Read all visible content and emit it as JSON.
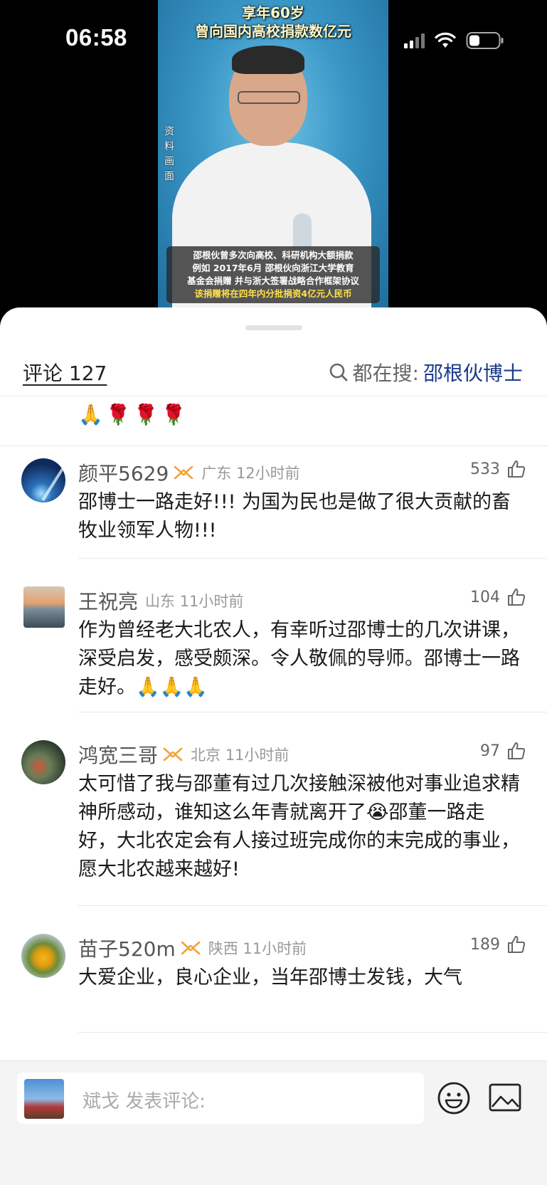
{
  "status_bar": {
    "time": "06:58"
  },
  "video": {
    "title_line1": "享年60岁",
    "title_line2": "曾向国内高校捐款数亿元",
    "side_note": [
      "资",
      "料",
      "画",
      "面"
    ],
    "caption_lines": [
      "邵根伙曾多次向高校、科研机构大额捐款",
      "例如 2017年6月 邵根伙向浙江大学教育",
      "基金会捐赠 并与浙大签署战略合作框架协议",
      "该捐赠将在四年内分批捐资4亿元人民币"
    ]
  },
  "comments_header": {
    "count_label": "评论 127",
    "search_label": "都在搜:",
    "search_term": "邵根伙博士"
  },
  "partial_comment_emojis": [
    "🙏",
    "🌹",
    "🌹",
    "🌹"
  ],
  "comments": [
    {
      "name": "颜平5629",
      "location_time": "广东 12小时前",
      "likes": "533",
      "text": "邵博士一路走好!!! 为国为民也是做了很大贡献的畜牧业领军人物!!!"
    },
    {
      "name": "王祝亮",
      "location_time": "山东 11小时前",
      "likes": "104",
      "text": "作为曾经老大北农人，有幸听过邵博士的几次讲课，深受启发，感受颇深。令人敬佩的导师。邵博士一路走好。🙏🙏🙏"
    },
    {
      "name": "鸿宽三哥",
      "location_time": "北京 11小时前",
      "likes": "97",
      "text": "太可惜了我与邵董有过几次接触深被他对事业追求精神所感动，谁知这么年青就离开了😭邵董一路走好，大北农定会有人接过班完成你的末完成的事业，愿大北农越来越好!"
    },
    {
      "name": "苗子520m",
      "location_time": "陕西 11小时前",
      "likes": "189",
      "text": "大爱企业，良心企业，当年邵博士发钱，大气"
    }
  ],
  "bottom_bar": {
    "placeholder": "斌戈 发表评论:"
  },
  "colors": {
    "search_term": "#1c3b8a",
    "badge": "#f2a33a"
  }
}
